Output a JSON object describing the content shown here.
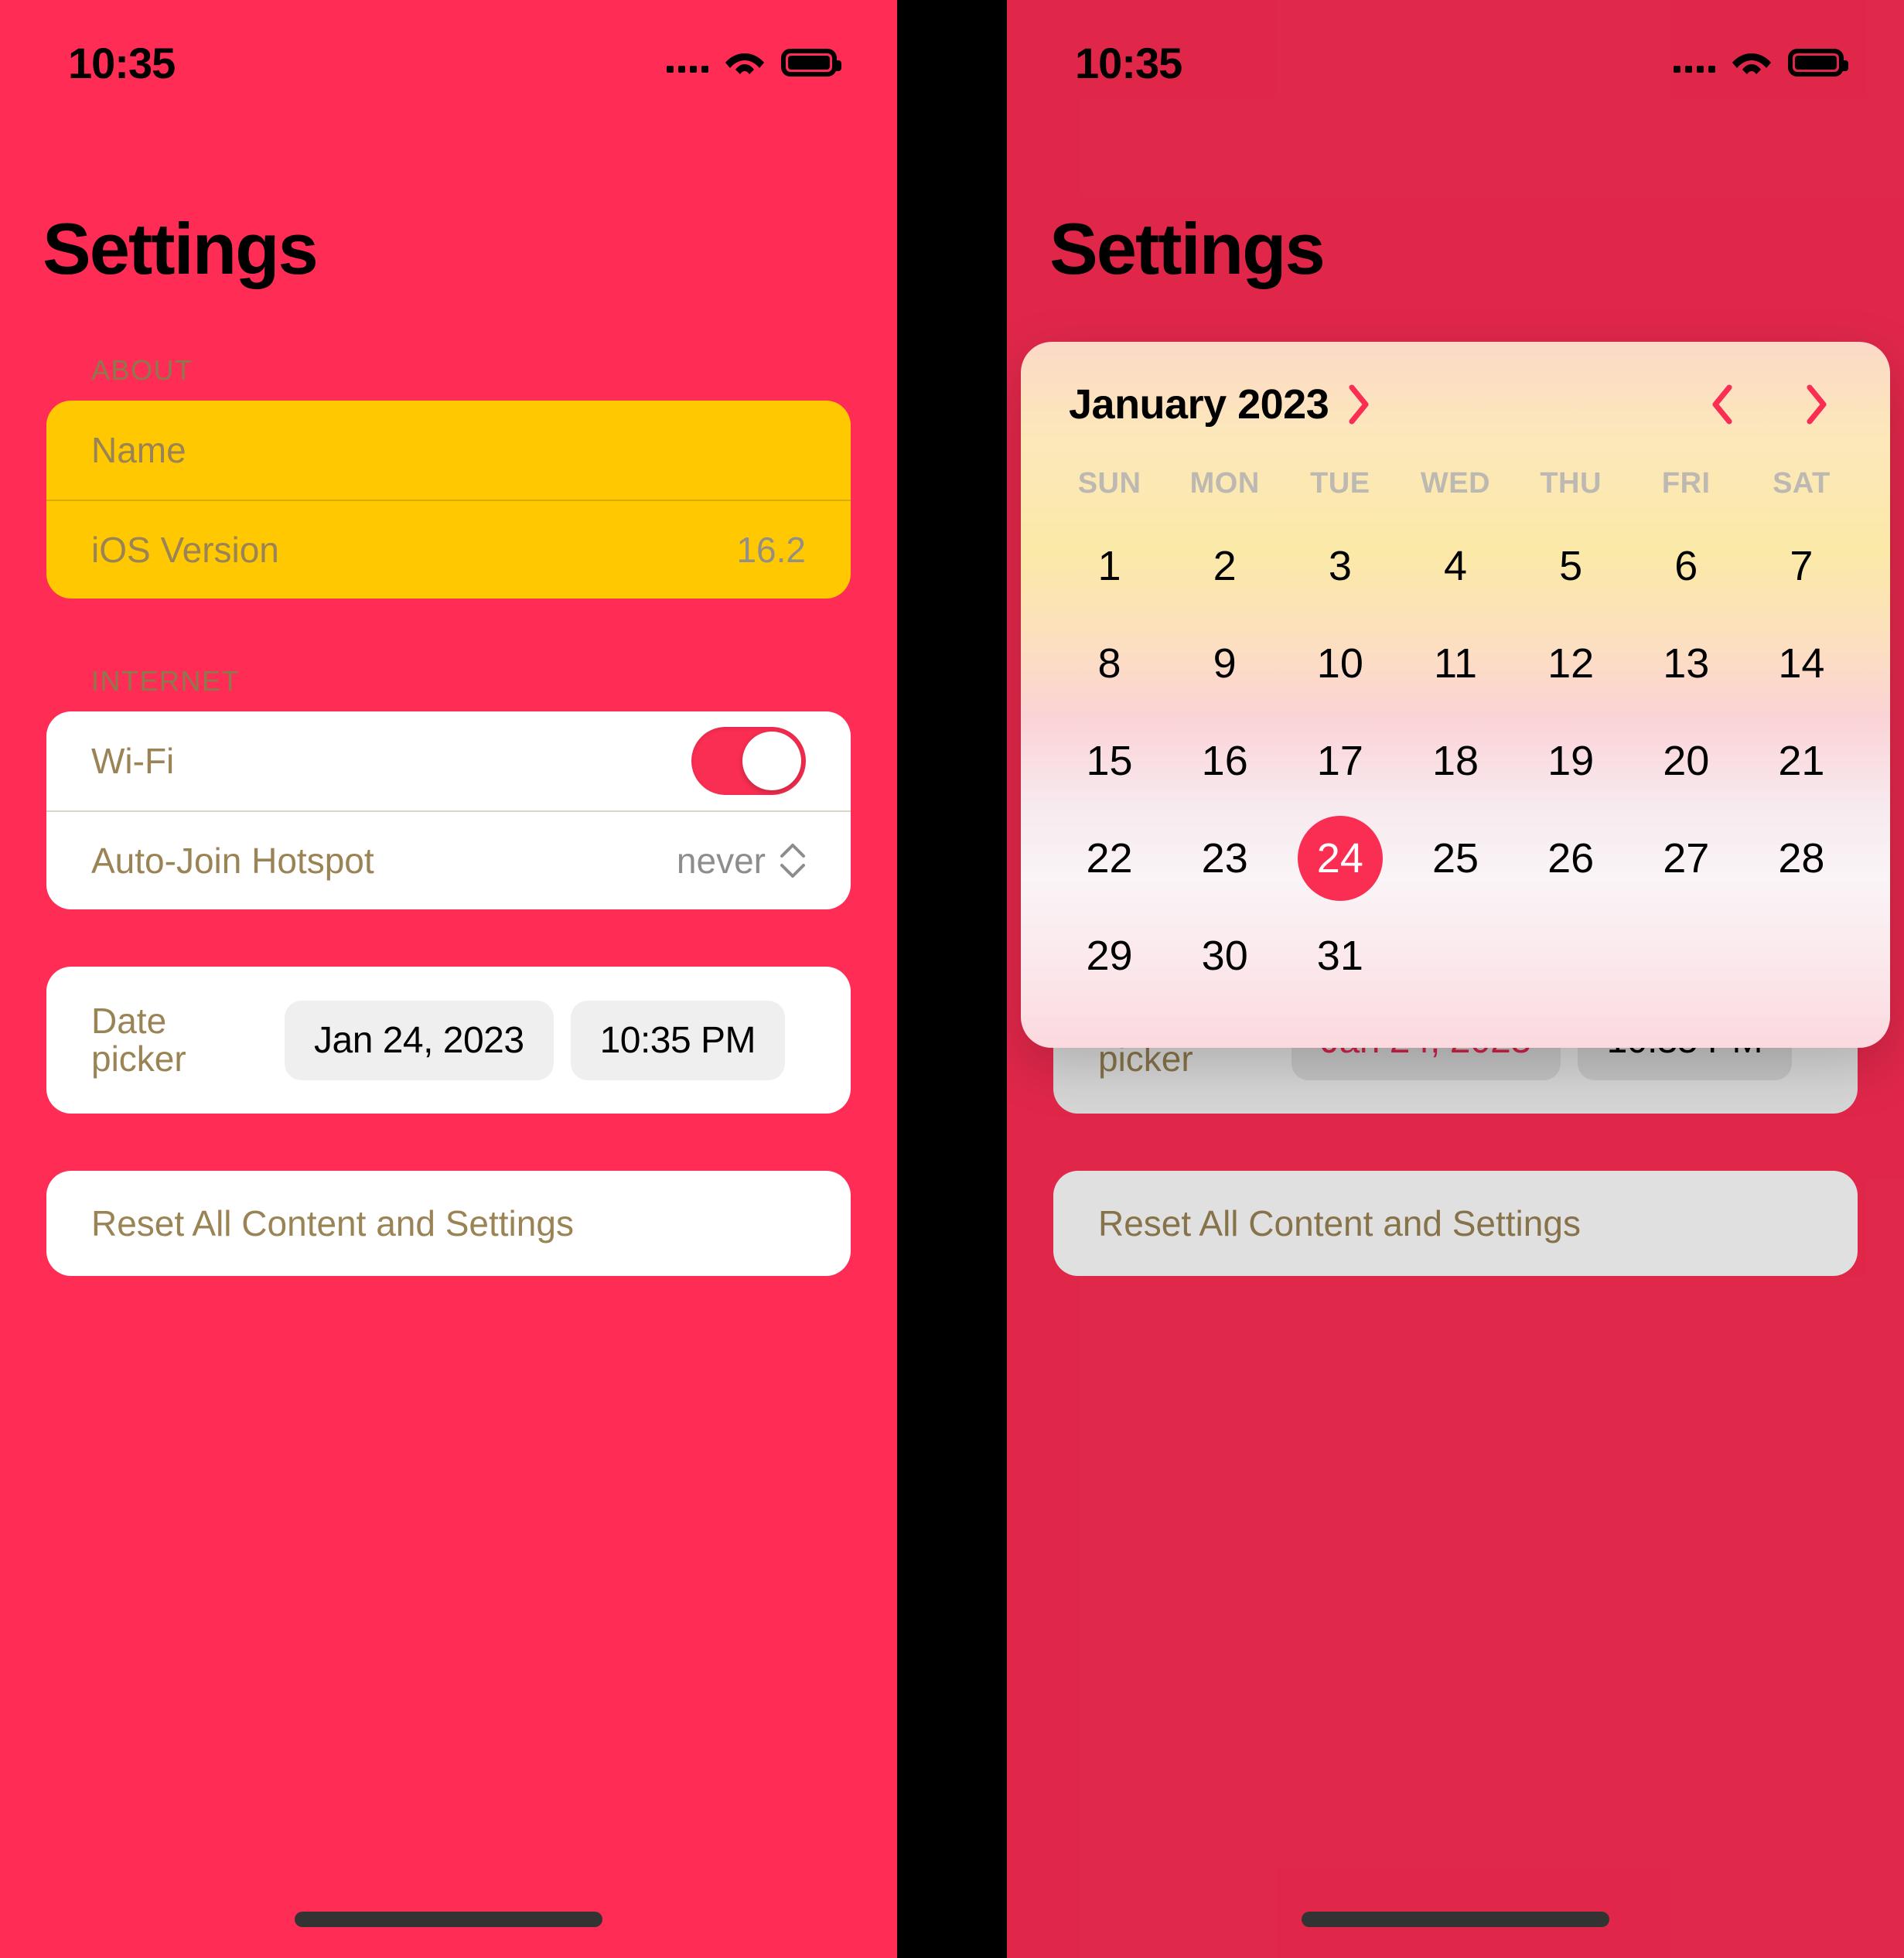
{
  "status_bar": {
    "time": "10:35",
    "signal_icon": "signal-dots-icon",
    "wifi_icon": "wifi-icon",
    "battery_icon": "battery-full-icon"
  },
  "page_title": "Settings",
  "sections": {
    "about": {
      "label": "ABOUT",
      "rows": [
        {
          "label": "Name",
          "value": ""
        },
        {
          "label": "iOS Version",
          "value": "16.2"
        }
      ]
    },
    "internet": {
      "label": "INTERNET",
      "rows": [
        {
          "label": "Wi-Fi",
          "toggle_on": true
        },
        {
          "label": "Auto-Join Hotspot",
          "value": "never",
          "stepper_icon": "chevron-up-down-icon"
        }
      ]
    },
    "date_picker": {
      "label_line1": "Date",
      "label_line2": "picker",
      "date_value": "Jan 24, 2023",
      "time_value": "10:35 PM"
    },
    "reset": {
      "label": "Reset All Content and Settings"
    }
  },
  "calendar": {
    "month_title": "January 2023",
    "expand_icon": "chevron-right-icon",
    "prev_icon": "chevron-left-icon",
    "next_icon": "chevron-right-icon",
    "day_headers": [
      "SUN",
      "MON",
      "TUE",
      "WED",
      "THU",
      "FRI",
      "SAT"
    ],
    "weeks": [
      [
        "1",
        "2",
        "3",
        "4",
        "5",
        "6",
        "7"
      ],
      [
        "8",
        "9",
        "10",
        "11",
        "12",
        "13",
        "14"
      ],
      [
        "15",
        "16",
        "17",
        "18",
        "19",
        "20",
        "21"
      ],
      [
        "22",
        "23",
        "24",
        "25",
        "26",
        "27",
        "28"
      ],
      [
        "29",
        "30",
        "31",
        "",
        "",
        "",
        ""
      ]
    ],
    "selected_day": "24"
  },
  "colors": {
    "background": "#FF2D55",
    "accent": "#F92E52",
    "about_card": "#FFC800",
    "card": "#FFFFFF",
    "label_text": "#9A8354",
    "selected_day_bg": "#F92E52"
  }
}
